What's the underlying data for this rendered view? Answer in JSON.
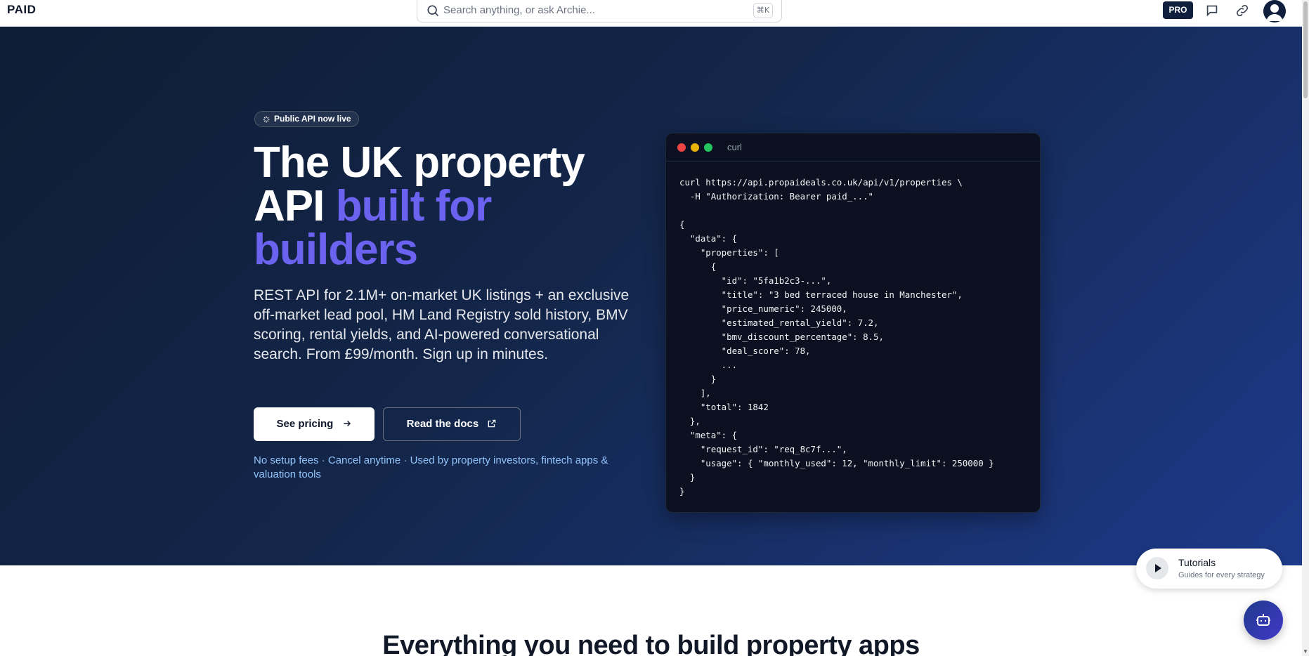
{
  "header": {
    "logo": "PAID",
    "search_placeholder": "Search anything, or ask Archie...",
    "search_shortcut": "⌘K",
    "pro_badge": "PRO"
  },
  "hero": {
    "badge": "Public API now live",
    "title_line1": "The UK property",
    "title_line2_prefix": "API ",
    "title_line2_accent": "built for",
    "title_line3_accent": "builders",
    "lead": "REST API for 2.1M+ on-market UK listings + an exclusive off-market lead pool, HM Land Registry sold history, BMV scoring, rental yields, and AI-powered conversational search. From £99/month. Sign up in minutes.",
    "primary_button": "See pricing",
    "secondary_button": "Read the docs",
    "fine_print": "No setup fees · Cancel anytime · Used by property investors, fintech apps & valuation tools"
  },
  "code_window": {
    "title": "curl",
    "code": "curl https://api.propaideals.co.uk/api/v1/properties \\\n  -H \"Authorization: Bearer paid_...\"\n\n{\n  \"data\": {\n    \"properties\": [\n      {\n        \"id\": \"5fa1b2c3-...\",\n        \"title\": \"3 bed terraced house in Manchester\",\n        \"price_numeric\": 245000,\n        \"estimated_rental_yield\": 7.2,\n        \"bmv_discount_percentage\": 8.5,\n        \"deal_score\": 78,\n        ...\n      }\n    ],\n    \"total\": 1842\n  },\n  \"meta\": {\n    \"request_id\": \"req_8c7f...\",\n    \"usage\": { \"monthly_used\": 12, \"monthly_limit\": 250000 }\n  }\n}"
  },
  "tutorials": {
    "title": "Tutorials",
    "subtitle": "Guides for every strategy"
  },
  "section": {
    "heading": "Everything you need to build property apps"
  },
  "colors": {
    "accent": "#6b63f0",
    "navy": "#0f1f3d",
    "fine_print": "#93c5fd"
  }
}
